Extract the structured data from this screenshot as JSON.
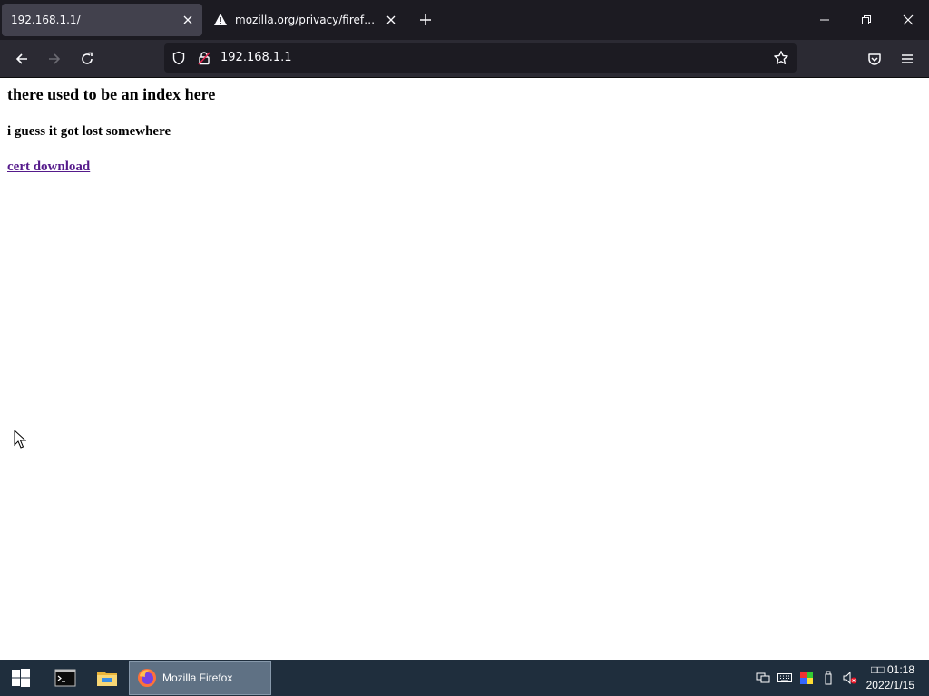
{
  "browser": {
    "tabs": [
      {
        "title": "192.168.1.1/",
        "active": true
      },
      {
        "title": "mozilla.org/privacy/firefox/",
        "active": false,
        "icon": "warning-icon"
      }
    ],
    "url": "192.168.1.1"
  },
  "page": {
    "heading": "there used to be an index here",
    "subheading": "i guess it got lost somewhere",
    "link": "cert download"
  },
  "taskbar": {
    "firefox_label": "Mozilla Firefox",
    "clock_time": "□□ 01:18",
    "clock_date": "2022/1/15"
  },
  "colors": {
    "tabstrip_bg": "#1c1b22",
    "navbar_bg": "#2b2a33",
    "taskbar_bg": "#1f2e3d",
    "visited_link": "#551a8b"
  }
}
